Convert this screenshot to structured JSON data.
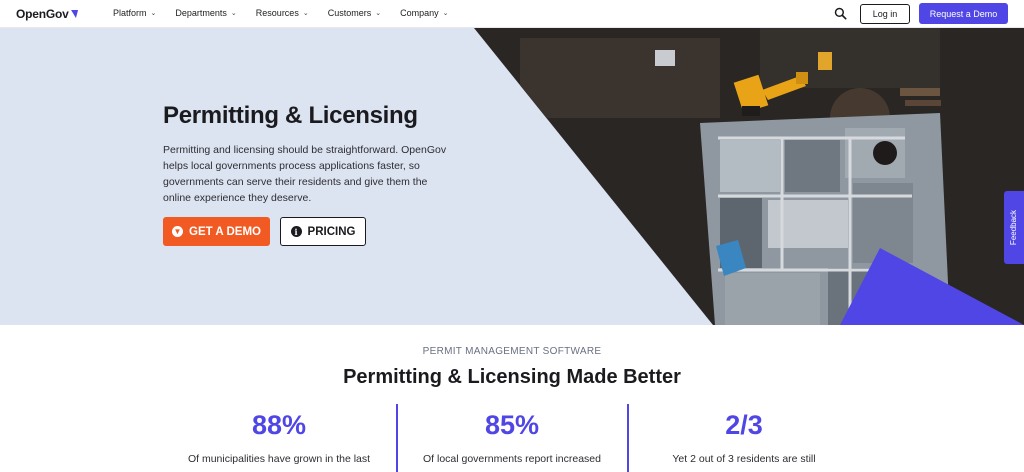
{
  "nav": {
    "logo": "OpenGov",
    "menu": [
      "Platform",
      "Departments",
      "Resources",
      "Customers",
      "Company"
    ],
    "login_label": "Log in",
    "demo_label": "Request a Demo"
  },
  "hero": {
    "title": "Permitting & Licensing",
    "description": "Permitting and licensing should be straightforward. OpenGov helps local governments process applications faster, so governments can serve their residents and give them the online experience they deserve.",
    "get_demo_label": "GET A DEMO",
    "pricing_label": "PRICING"
  },
  "feedback_label": "Feedback",
  "section": {
    "eyebrow": "PERMIT MANAGEMENT SOFTWARE",
    "title": "Permitting & Licensing Made Better",
    "stats": [
      {
        "value": "88%",
        "text": "Of municipalities have grown in the last"
      },
      {
        "value": "85%",
        "text": "Of local governments report increased"
      },
      {
        "value": "2/3",
        "text": "Yet 2 out of 3 residents are still"
      }
    ]
  },
  "colors": {
    "accent": "#4f46e5",
    "cta": "#f15a22",
    "hero_bg": "#dde4f1"
  },
  "icons": [
    "search-icon",
    "chevron-down-icon",
    "download-circle-icon",
    "info-circle-icon"
  ]
}
